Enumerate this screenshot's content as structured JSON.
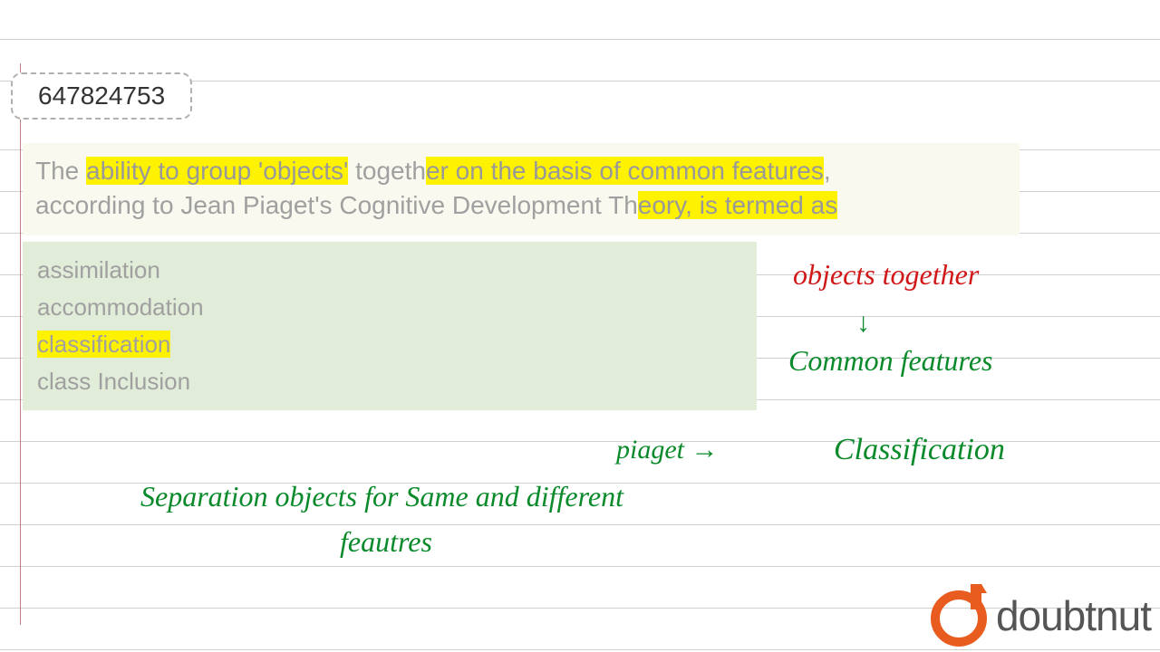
{
  "question_id": "647824753",
  "question": {
    "pre1": "The ",
    "hl1": "ability to group 'objects'",
    "mid1": " togeth",
    "hl2": "er on the basis of common features",
    "post1": ", ",
    "pre2": "according to Jean Piaget's",
    "mid2": " Cognitive Development Th",
    "hl3": "eory, is termed as"
  },
  "options": {
    "a": "assimilation",
    "b": "accommodation",
    "c": "classification",
    "d": "class Inclusion"
  },
  "annotations": {
    "red1": "objects together",
    "green1": "Common features",
    "green2": "piaget →",
    "green3": "Classification",
    "green4": "Separation objects for Same and different",
    "green5": "feautres"
  },
  "logo_text": "doubtnut"
}
